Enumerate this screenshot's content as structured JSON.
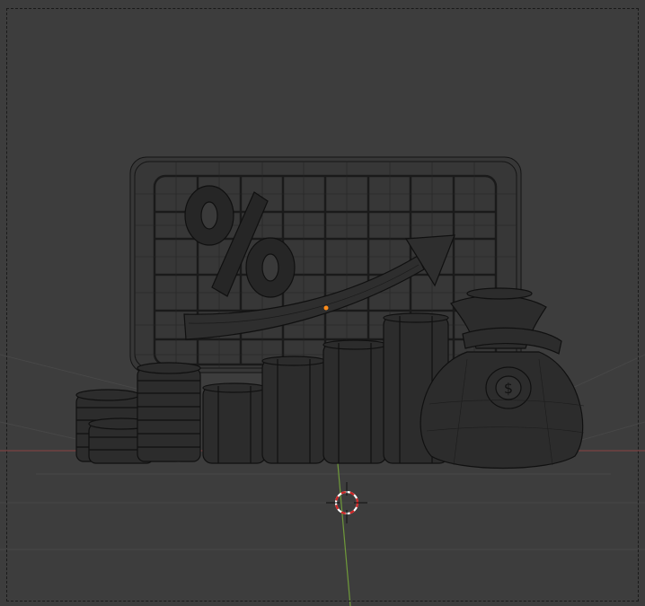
{
  "viewport": {
    "background": "#3d3d3d",
    "grid_color": "#4a4a4a",
    "x_axis_color": "#8a4343",
    "y_axis_color": "#6f9a3a",
    "wire_color": "#141414",
    "mesh_fill": "#2b2b2b",
    "origin_color": "#ff8c1a",
    "cursor_colors": [
      "#d02525",
      "#ffffff"
    ]
  },
  "icons": [
    "camera-frame-dashed",
    "percent-sign",
    "growth-arrow",
    "coin-stack",
    "bar-cylinder",
    "money-bag",
    "dollar-coin",
    "3d-cursor-icon"
  ]
}
